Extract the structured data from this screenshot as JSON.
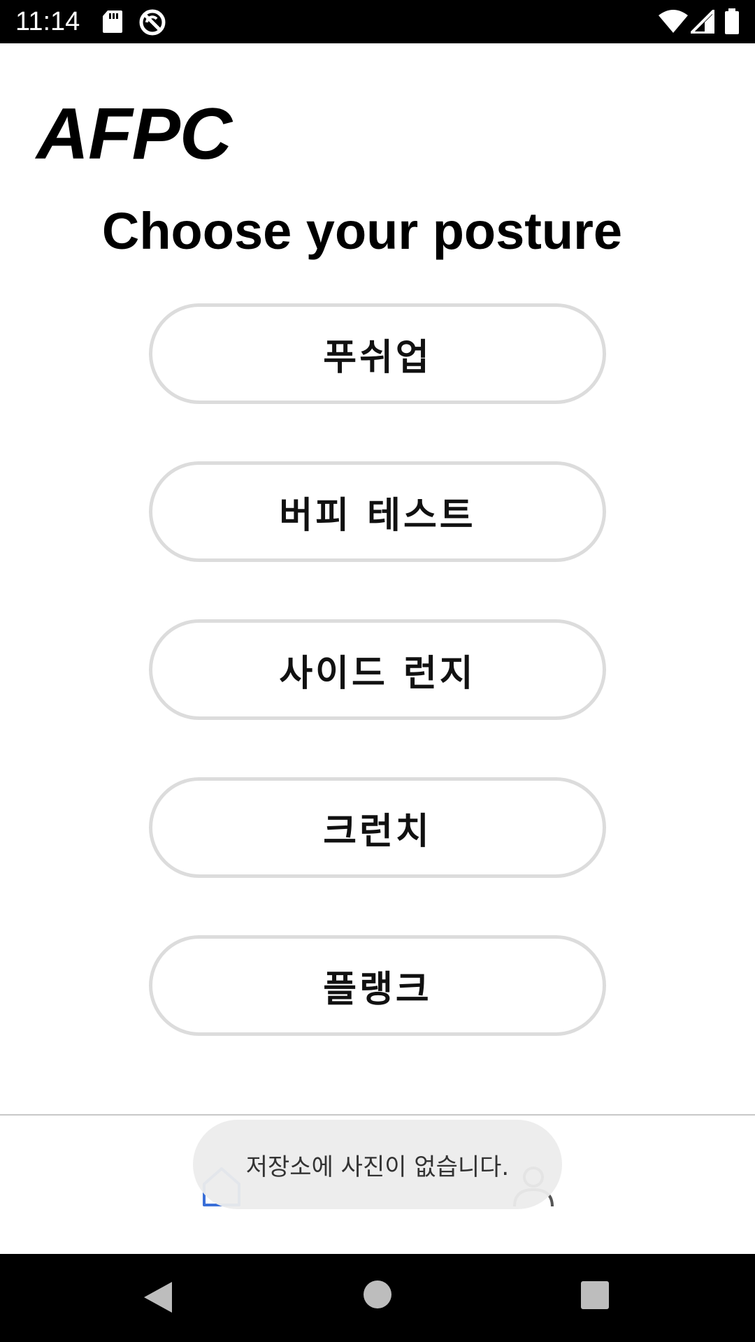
{
  "status_bar": {
    "time": "11:14",
    "icons": [
      "sd-card-icon",
      "sync-disabled-icon",
      "wifi-icon",
      "cellular-signal-icon",
      "battery-icon"
    ]
  },
  "app": {
    "title": "AFPC"
  },
  "main": {
    "heading": "Choose your posture",
    "postures": [
      {
        "label": "푸쉬업"
      },
      {
        "label": "버피 테스트"
      },
      {
        "label": "사이드 런지"
      },
      {
        "label": "크런치"
      },
      {
        "label": "플랭크"
      }
    ]
  },
  "bottom_nav": {
    "items": [
      {
        "icon": "home-icon"
      },
      {
        "icon": "profile-icon"
      }
    ]
  },
  "toast": {
    "message": "저장소에 사진이 없습니다."
  },
  "system_nav": {
    "buttons": [
      "back-icon",
      "home-circle-icon",
      "recents-icon"
    ]
  },
  "colors": {
    "button_border": "#dcdcdc",
    "status_bar_bg": "#000000",
    "toast_bg": "#ececec"
  }
}
